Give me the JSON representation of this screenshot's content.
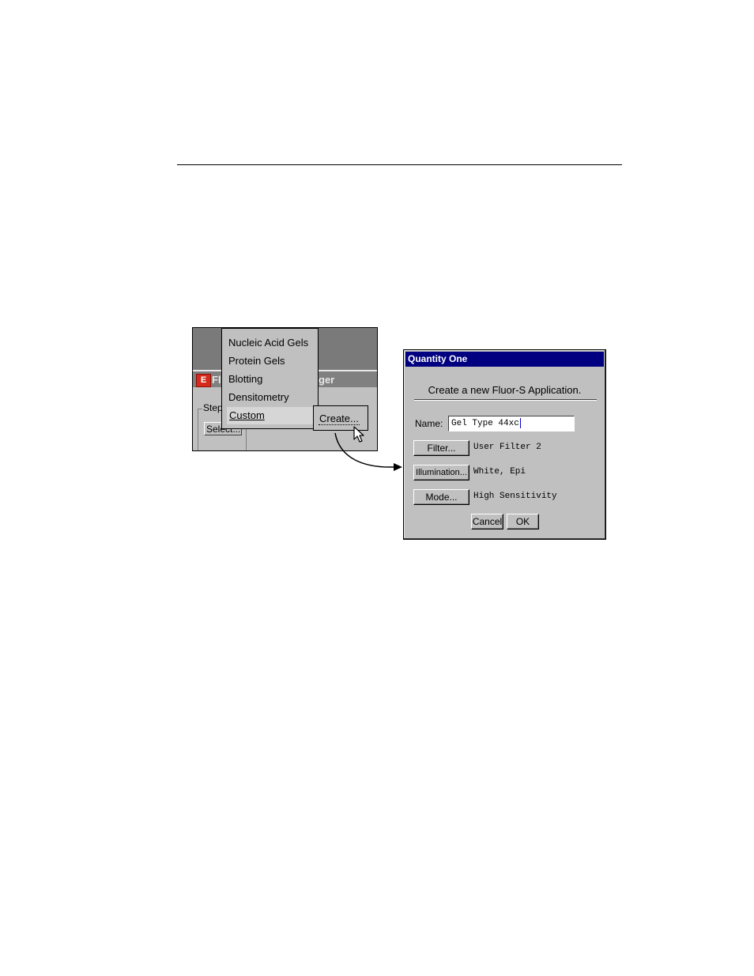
{
  "menu": {
    "items": [
      "Nucleic Acid Gels",
      "Protein Gels",
      "Blotting",
      "Densitometry",
      "Custom"
    ],
    "submenu_label": "Create..."
  },
  "background_window": {
    "title_left": "Fl",
    "title_right": "ger",
    "group_label": "Step",
    "select_button": "Select...",
    "icon": "application-icon"
  },
  "dialog": {
    "title": "Quantity One",
    "heading": "Create a new Fluor-S Application.",
    "name_label": "Name:",
    "name_value": "Gel Type 44xc",
    "rows": [
      {
        "button": "Filter...",
        "value": "User Filter 2"
      },
      {
        "button": "Illumination...",
        "value": "White, Epi"
      },
      {
        "button": "Mode...",
        "value": "High Sensitivity"
      }
    ],
    "cancel_label": "Cancel",
    "ok_label": "OK",
    "title_color": "#000080"
  }
}
